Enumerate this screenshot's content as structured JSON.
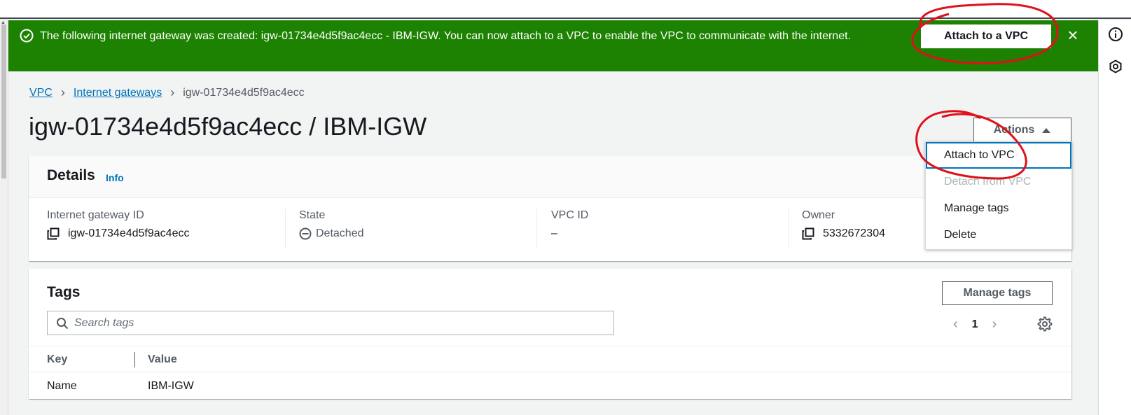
{
  "flash": {
    "message": "The following internet gateway was created: igw-01734e4d5f9ac4ecc - IBM-IGW. You can now attach to a VPC to enable the VPC to communicate with the internet.",
    "attach_button": "Attach to a VPC",
    "close_label": "×"
  },
  "breadcrumb": {
    "root": "VPC",
    "section": "Internet gateways",
    "current": "igw-01734e4d5f9ac4ecc"
  },
  "page_title": "igw-01734e4d5f9ac4ecc / IBM-IGW",
  "actions": {
    "label": "Actions",
    "menu": [
      {
        "label": "Attach to VPC",
        "state": "focused"
      },
      {
        "label": "Detach from VPC",
        "state": "disabled"
      },
      {
        "label": "Manage tags",
        "state": "enabled"
      },
      {
        "label": "Delete",
        "state": "enabled"
      }
    ]
  },
  "details": {
    "title": "Details",
    "info_link": "Info",
    "fields": [
      {
        "label": "Internet gateway ID",
        "value": "igw-01734e4d5f9ac4ecc"
      },
      {
        "label": "State",
        "value": "Detached"
      },
      {
        "label": "VPC ID",
        "value": "–"
      },
      {
        "label": "Owner",
        "value": "5332672304"
      }
    ]
  },
  "tags": {
    "title": "Tags",
    "manage_button": "Manage tags",
    "search_placeholder": "Search tags",
    "page": "1",
    "columns": {
      "key": "Key",
      "value": "Value"
    },
    "rows": [
      {
        "key": "Name",
        "value": "IBM-IGW"
      }
    ]
  },
  "colors": {
    "success_green": "#1d8102",
    "link_blue": "#0073bb",
    "annotation_red": "#e0101a"
  }
}
